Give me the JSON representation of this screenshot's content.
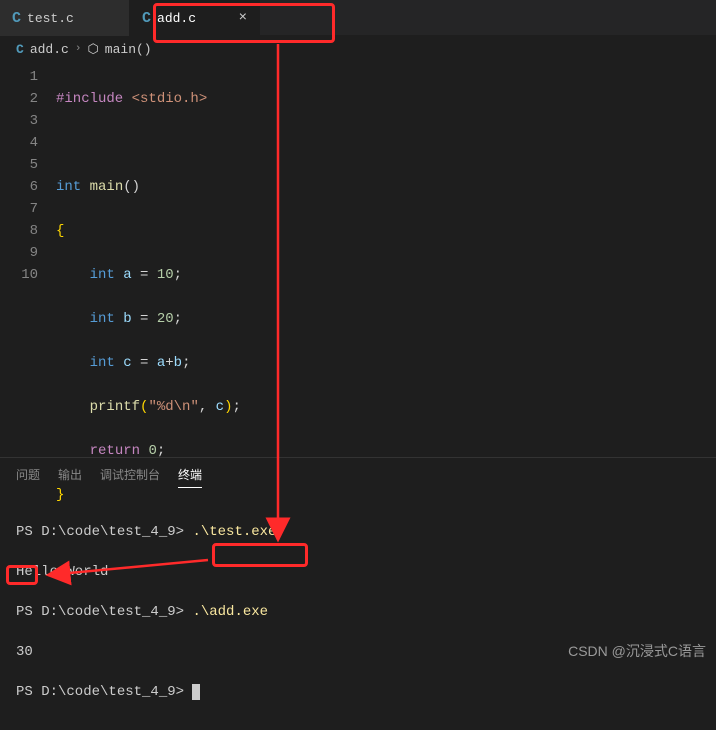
{
  "tabs": [
    {
      "icon": "C",
      "label": "test.c"
    },
    {
      "icon": "C",
      "label": "add.c"
    }
  ],
  "breadcrumb": {
    "file_icon": "C",
    "file": "add.c",
    "sep": "›",
    "sym_icon": "⬡",
    "symbol": "main()"
  },
  "code": {
    "lines": [
      "1",
      "2",
      "3",
      "4",
      "5",
      "6",
      "7",
      "8",
      "9",
      "10"
    ],
    "l1_pp": "#include",
    "l1_inc": "<stdio.h>",
    "l3_kw1": "int",
    "l3_fn": "main",
    "l3_paren": "()",
    "l4_brace": "{",
    "l5_kw": "int",
    "l5_var": "a",
    "l5_eq": " = ",
    "l5_num": "10",
    "l5_semi": ";",
    "l6_kw": "int",
    "l6_var": "b",
    "l6_eq": " = ",
    "l6_num": "20",
    "l6_semi": ";",
    "l7_kw": "int",
    "l7_var": "c",
    "l7_eq": " = ",
    "l7_expr_a": "a",
    "l7_plus": "+",
    "l7_expr_b": "b",
    "l7_semi": ";",
    "l8_fn": "printf",
    "l8_open": "(",
    "l8_str": "\"%d\\n\"",
    "l8_comma": ", ",
    "l8_arg": "c",
    "l8_close": ")",
    "l8_semi": ";",
    "l9_ret": "return",
    "l9_sp": " ",
    "l9_num": "0",
    "l9_semi": ";",
    "l10_brace": "}"
  },
  "panel": {
    "tabs": [
      "问题",
      "输出",
      "调试控制台",
      "终端"
    ],
    "active": 3
  },
  "terminal": {
    "prompt": "PS D:\\code\\test_4_9> ",
    "cmd1": ".\\test.exe",
    "out1": "Hello World",
    "cmd2": ".\\add.exe",
    "out2": "30"
  },
  "watermark": "CSDN @沉浸式C语言"
}
